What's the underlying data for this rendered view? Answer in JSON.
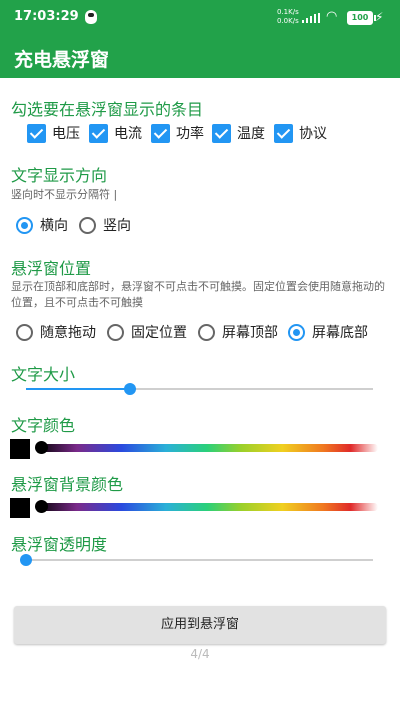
{
  "status": {
    "time": "17:03:29",
    "net_up": "0.1K/s",
    "net_down": "0.0K/s",
    "battery": "100"
  },
  "app": {
    "title": "充电悬浮窗"
  },
  "items_section": {
    "title": "勾选要在悬浮窗显示的条目",
    "items": [
      "电压",
      "电流",
      "功率",
      "温度",
      "协议"
    ]
  },
  "direction_section": {
    "title": "文字显示方向",
    "hint": "竖向时不显示分隔符 |",
    "options": [
      "横向",
      "竖向"
    ],
    "selected": "横向"
  },
  "position_section": {
    "title": "悬浮窗位置",
    "hint": "显示在顶部和底部时，悬浮窗不可点击不可触摸。固定位置会使用随意拖动的位置，且不可点击不可触摸",
    "options": [
      "随意拖动",
      "固定位置",
      "屏幕顶部",
      "屏幕底部"
    ],
    "selected": "屏幕底部"
  },
  "text_size": {
    "title": "文字大小",
    "value_fraction": 0.3
  },
  "text_color": {
    "title": "文字颜色",
    "color": "#000000"
  },
  "bg_color": {
    "title": "悬浮窗背景颜色",
    "color": "#000000"
  },
  "opacity": {
    "title": "悬浮窗透明度",
    "value_fraction": 0.0
  },
  "apply_button": {
    "label": "应用到悬浮窗"
  },
  "pager": {
    "text": "4/4"
  },
  "colors": {
    "accent_green": "#22a24a",
    "accent_blue": "#2296f3"
  }
}
